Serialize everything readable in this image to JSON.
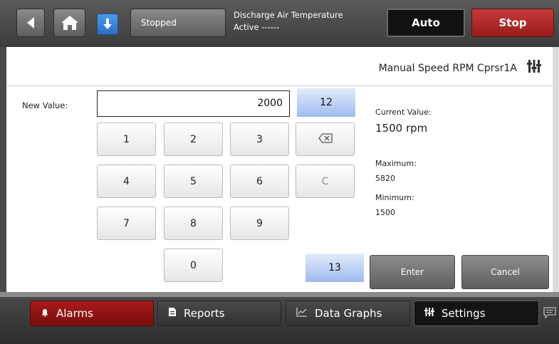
{
  "header": {
    "status_label": "Stopped",
    "alarm_line1": "Discharge Air Temperature",
    "alarm_line2": "Active ------",
    "auto_label": "Auto",
    "stop_label": "Stop"
  },
  "panel": {
    "title": "Manual Speed RPM Cprsr1A",
    "new_value_label": "New Value:",
    "new_value": "2000",
    "keys": [
      "1",
      "2",
      "3",
      "4",
      "5",
      "6",
      "7",
      "8",
      "9",
      "0"
    ],
    "clear_key": "C",
    "markers": [
      "12",
      "13"
    ],
    "current_value_label": "Current Value:",
    "current_value": "1500 rpm",
    "maximum_label": "Maximum:",
    "maximum_value": "5820",
    "minimum_label": "Minimum:",
    "minimum_value": "1500",
    "enter_label": "Enter",
    "cancel_label": "Cancel"
  },
  "nav": {
    "alarms": "Alarms",
    "reports": "Reports",
    "data_graphs": "Data Graphs",
    "settings": "Settings"
  },
  "colors": {
    "stop_red": "#9a1c1c",
    "alarm_tab_red": "#7a0d0d",
    "marker_blue": "#9fbaf0",
    "download_blue": "#2c6fc0"
  }
}
